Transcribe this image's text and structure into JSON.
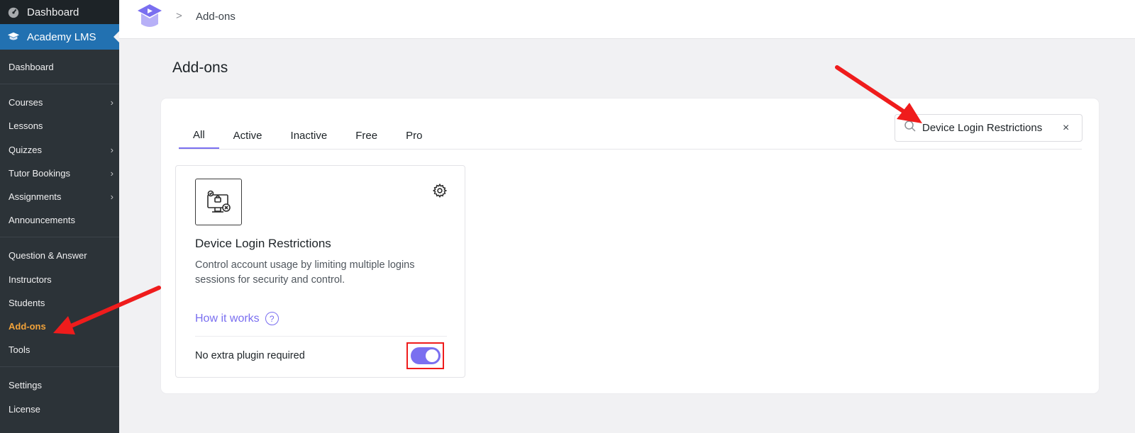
{
  "sidebar": {
    "dashboard_label": "Dashboard",
    "plugin_label": "Academy LMS",
    "submenu": [
      {
        "label": "Dashboard",
        "has_children": false,
        "active": false
      },
      {
        "label": "Courses",
        "has_children": true,
        "active": false
      },
      {
        "label": "Lessons",
        "has_children": false,
        "active": false
      },
      {
        "label": "Quizzes",
        "has_children": true,
        "active": false
      },
      {
        "label": "Tutor Bookings",
        "has_children": true,
        "active": false
      },
      {
        "label": "Assignments",
        "has_children": true,
        "active": false
      },
      {
        "label": "Announcements",
        "has_children": false,
        "active": false
      },
      {
        "label": "Question & Answer",
        "has_children": false,
        "active": false
      },
      {
        "label": "Instructors",
        "has_children": false,
        "active": false
      },
      {
        "label": "Students",
        "has_children": false,
        "active": false
      },
      {
        "label": "Add-ons",
        "has_children": false,
        "active": true
      },
      {
        "label": "Tools",
        "has_children": false,
        "active": false
      },
      {
        "label": "Settings",
        "has_children": false,
        "active": false
      },
      {
        "label": "License",
        "has_children": false,
        "active": false
      }
    ],
    "chevron": "›"
  },
  "topbar": {
    "breadcrumb_sep": ">",
    "breadcrumb": "Add-ons"
  },
  "page": {
    "title": "Add-ons",
    "tabs": [
      {
        "label": "All",
        "active": true
      },
      {
        "label": "Active",
        "active": false
      },
      {
        "label": "Inactive",
        "active": false
      },
      {
        "label": "Free",
        "active": false
      },
      {
        "label": "Pro",
        "active": false
      }
    ],
    "search": {
      "value": "Device Login Restrictions",
      "clear_icon": "×"
    }
  },
  "addon": {
    "title": "Device Login Restrictions",
    "description": "Control account usage by limiting multiple logins sessions for security and control.",
    "how_label": "How it works",
    "how_icon": "?",
    "footer_text": "No extra plugin required",
    "enabled": true
  },
  "colors": {
    "accent": "#7a6ff0",
    "active_menu": "#f2a33a",
    "annotation": "#ef1c1c",
    "wp_blue": "#2271b1"
  }
}
